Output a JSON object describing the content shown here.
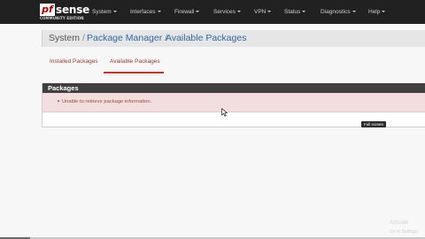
{
  "brand": {
    "logo_mark": "pf",
    "logo_word": "sense",
    "edition": "COMMUNITY EDITION",
    "accent_color": "#b00000"
  },
  "nav": {
    "items": [
      {
        "label": "System"
      },
      {
        "label": "Interfaces"
      },
      {
        "label": "Firewall"
      },
      {
        "label": "Services"
      },
      {
        "label": "VPN"
      },
      {
        "label": "Status"
      },
      {
        "label": "Diagnostics"
      },
      {
        "label": "Help"
      }
    ],
    "dropdown_icon": "caret-down-icon"
  },
  "breadcrumb": {
    "system": "System",
    "separator": "/",
    "package_manager": "Package Manager",
    "available_packages": "Available Packages"
  },
  "tabs": [
    {
      "label": "Installed Packages",
      "active": false
    },
    {
      "label": "Available Packages",
      "active": true
    }
  ],
  "panel": {
    "title": "Packages",
    "error_message": "Unable to retrieve package information."
  },
  "tooltip": {
    "text": "Full screen"
  },
  "watermark": {
    "line1": "Activate",
    "line2": "Go to Settings"
  },
  "video_progress": 0.07,
  "colors": {
    "navbar": "#212121",
    "link": "#2d6aa7",
    "tab_active_underline": "#c9322a",
    "panel_heading": "#404040",
    "alert_bg": "#f2dede",
    "alert_text": "#a94442"
  }
}
